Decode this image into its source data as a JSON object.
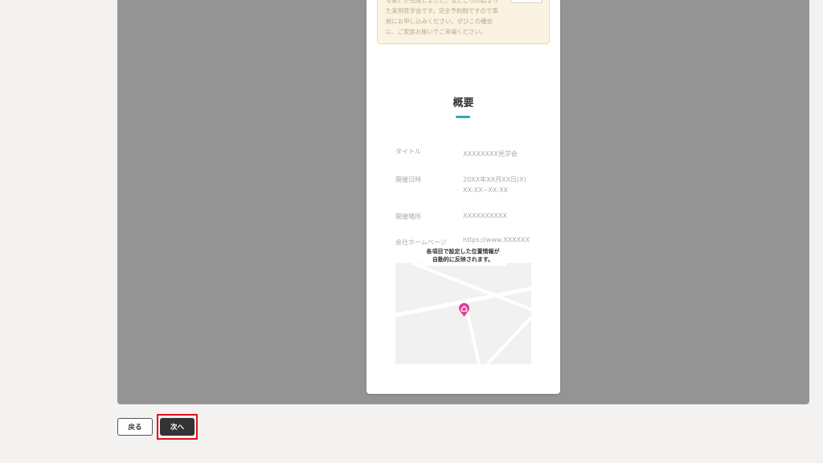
{
  "notice": {
    "text": "る家》が完成しました。見どころの詰まっ\nた実例見学会です。完全予約制ですので事\n前にお申し込みください。ぜひこの機会\nに、ご家族お揃いでご来場ください。"
  },
  "overview": {
    "title": "概要",
    "rows": [
      {
        "label": "タイトル",
        "value": "XXXXXXXX見学会"
      },
      {
        "label": "開催日時",
        "value": "20XX年XX月XX日(X)\nXX:XX~XX:XX"
      },
      {
        "label": "開催場所",
        "value": "XXXXXXXXXX"
      },
      {
        "label": "会社ホームページ",
        "value": "https://www.XXXXXX"
      }
    ]
  },
  "map": {
    "tooltip": "各項目で設定した位置情報が\n自動的に反映されます。",
    "pin_icon": "home-pin-icon",
    "pin_color": "#e23d95"
  },
  "footer": {
    "back_label": "戻る",
    "next_label": "次へ"
  },
  "colors": {
    "accent": "#2fa9b7",
    "highlight": "#e0101e"
  }
}
